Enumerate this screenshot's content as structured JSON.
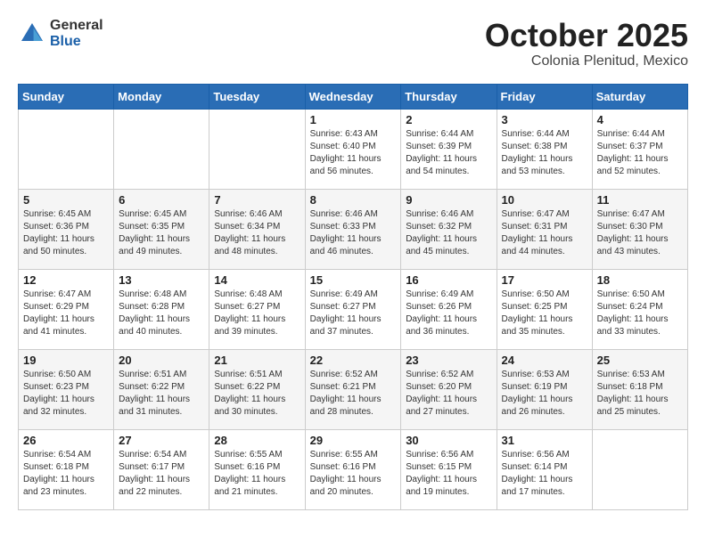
{
  "logo": {
    "general": "General",
    "blue": "Blue"
  },
  "header": {
    "month": "October 2025",
    "location": "Colonia Plenitud, Mexico"
  },
  "weekdays": [
    "Sunday",
    "Monday",
    "Tuesday",
    "Wednesday",
    "Thursday",
    "Friday",
    "Saturday"
  ],
  "weeks": [
    [
      {
        "day": "",
        "info": ""
      },
      {
        "day": "",
        "info": ""
      },
      {
        "day": "",
        "info": ""
      },
      {
        "day": "1",
        "info": "Sunrise: 6:43 AM\nSunset: 6:40 PM\nDaylight: 11 hours\nand 56 minutes."
      },
      {
        "day": "2",
        "info": "Sunrise: 6:44 AM\nSunset: 6:39 PM\nDaylight: 11 hours\nand 54 minutes."
      },
      {
        "day": "3",
        "info": "Sunrise: 6:44 AM\nSunset: 6:38 PM\nDaylight: 11 hours\nand 53 minutes."
      },
      {
        "day": "4",
        "info": "Sunrise: 6:44 AM\nSunset: 6:37 PM\nDaylight: 11 hours\nand 52 minutes."
      }
    ],
    [
      {
        "day": "5",
        "info": "Sunrise: 6:45 AM\nSunset: 6:36 PM\nDaylight: 11 hours\nand 50 minutes."
      },
      {
        "day": "6",
        "info": "Sunrise: 6:45 AM\nSunset: 6:35 PM\nDaylight: 11 hours\nand 49 minutes."
      },
      {
        "day": "7",
        "info": "Sunrise: 6:46 AM\nSunset: 6:34 PM\nDaylight: 11 hours\nand 48 minutes."
      },
      {
        "day": "8",
        "info": "Sunrise: 6:46 AM\nSunset: 6:33 PM\nDaylight: 11 hours\nand 46 minutes."
      },
      {
        "day": "9",
        "info": "Sunrise: 6:46 AM\nSunset: 6:32 PM\nDaylight: 11 hours\nand 45 minutes."
      },
      {
        "day": "10",
        "info": "Sunrise: 6:47 AM\nSunset: 6:31 PM\nDaylight: 11 hours\nand 44 minutes."
      },
      {
        "day": "11",
        "info": "Sunrise: 6:47 AM\nSunset: 6:30 PM\nDaylight: 11 hours\nand 43 minutes."
      }
    ],
    [
      {
        "day": "12",
        "info": "Sunrise: 6:47 AM\nSunset: 6:29 PM\nDaylight: 11 hours\nand 41 minutes."
      },
      {
        "day": "13",
        "info": "Sunrise: 6:48 AM\nSunset: 6:28 PM\nDaylight: 11 hours\nand 40 minutes."
      },
      {
        "day": "14",
        "info": "Sunrise: 6:48 AM\nSunset: 6:27 PM\nDaylight: 11 hours\nand 39 minutes."
      },
      {
        "day": "15",
        "info": "Sunrise: 6:49 AM\nSunset: 6:27 PM\nDaylight: 11 hours\nand 37 minutes."
      },
      {
        "day": "16",
        "info": "Sunrise: 6:49 AM\nSunset: 6:26 PM\nDaylight: 11 hours\nand 36 minutes."
      },
      {
        "day": "17",
        "info": "Sunrise: 6:50 AM\nSunset: 6:25 PM\nDaylight: 11 hours\nand 35 minutes."
      },
      {
        "day": "18",
        "info": "Sunrise: 6:50 AM\nSunset: 6:24 PM\nDaylight: 11 hours\nand 33 minutes."
      }
    ],
    [
      {
        "day": "19",
        "info": "Sunrise: 6:50 AM\nSunset: 6:23 PM\nDaylight: 11 hours\nand 32 minutes."
      },
      {
        "day": "20",
        "info": "Sunrise: 6:51 AM\nSunset: 6:22 PM\nDaylight: 11 hours\nand 31 minutes."
      },
      {
        "day": "21",
        "info": "Sunrise: 6:51 AM\nSunset: 6:22 PM\nDaylight: 11 hours\nand 30 minutes."
      },
      {
        "day": "22",
        "info": "Sunrise: 6:52 AM\nSunset: 6:21 PM\nDaylight: 11 hours\nand 28 minutes."
      },
      {
        "day": "23",
        "info": "Sunrise: 6:52 AM\nSunset: 6:20 PM\nDaylight: 11 hours\nand 27 minutes."
      },
      {
        "day": "24",
        "info": "Sunrise: 6:53 AM\nSunset: 6:19 PM\nDaylight: 11 hours\nand 26 minutes."
      },
      {
        "day": "25",
        "info": "Sunrise: 6:53 AM\nSunset: 6:18 PM\nDaylight: 11 hours\nand 25 minutes."
      }
    ],
    [
      {
        "day": "26",
        "info": "Sunrise: 6:54 AM\nSunset: 6:18 PM\nDaylight: 11 hours\nand 23 minutes."
      },
      {
        "day": "27",
        "info": "Sunrise: 6:54 AM\nSunset: 6:17 PM\nDaylight: 11 hours\nand 22 minutes."
      },
      {
        "day": "28",
        "info": "Sunrise: 6:55 AM\nSunset: 6:16 PM\nDaylight: 11 hours\nand 21 minutes."
      },
      {
        "day": "29",
        "info": "Sunrise: 6:55 AM\nSunset: 6:16 PM\nDaylight: 11 hours\nand 20 minutes."
      },
      {
        "day": "30",
        "info": "Sunrise: 6:56 AM\nSunset: 6:15 PM\nDaylight: 11 hours\nand 19 minutes."
      },
      {
        "day": "31",
        "info": "Sunrise: 6:56 AM\nSunset: 6:14 PM\nDaylight: 11 hours\nand 17 minutes."
      },
      {
        "day": "",
        "info": ""
      }
    ]
  ]
}
